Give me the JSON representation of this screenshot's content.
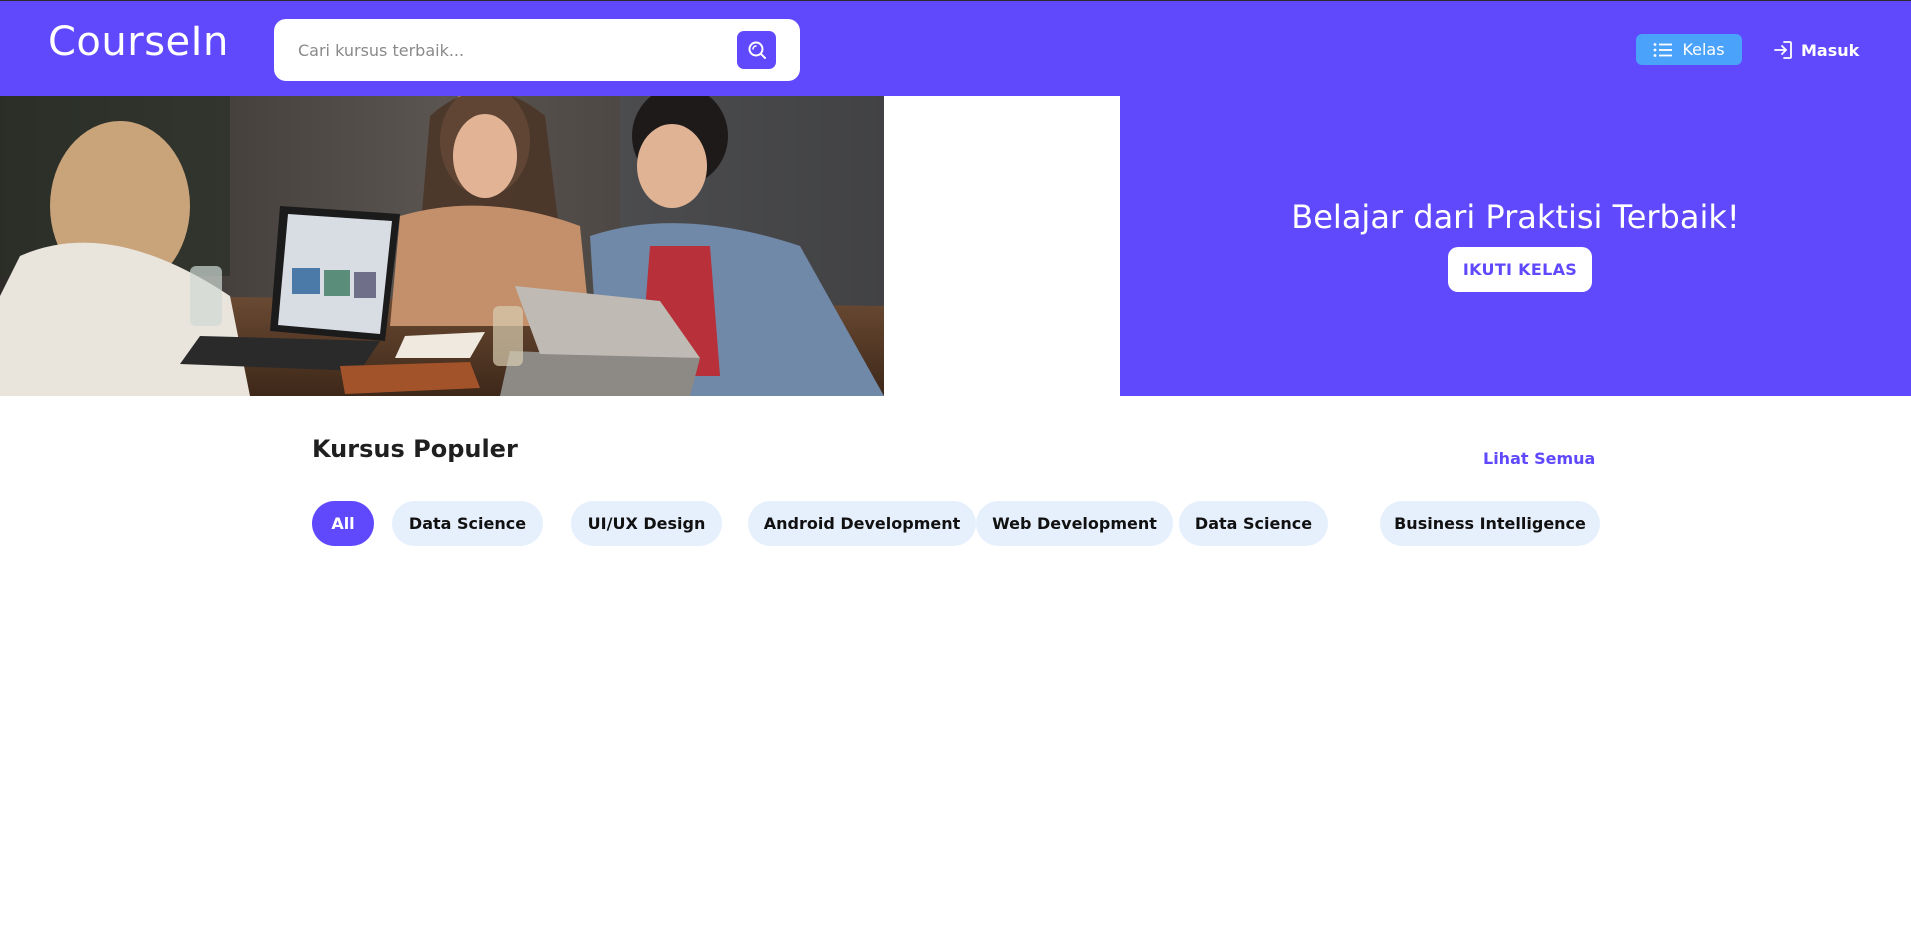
{
  "header": {
    "logo": "CourseIn",
    "search": {
      "placeholder": "Cari kursus terbaik...",
      "value": ""
    },
    "nav": {
      "kelas_label": "Kelas",
      "masuk_label": "Masuk"
    }
  },
  "hero": {
    "image_icon": "students-studying-photo",
    "title": "Belajar dari Praktisi Terbaik!",
    "cta_label": "IKUTI KELAS"
  },
  "popular": {
    "title": "Kursus Populer",
    "see_all_label": "Lihat Semua",
    "filters": [
      {
        "label": "All",
        "active": true
      },
      {
        "label": "Data Science",
        "active": false
      },
      {
        "label": "UI/UX Design",
        "active": false
      },
      {
        "label": "Android Development",
        "active": false
      },
      {
        "label": "Web Development",
        "active": false
      },
      {
        "label": "Data Science",
        "active": false
      },
      {
        "label": "Business Intelligence",
        "active": false
      }
    ]
  },
  "colors": {
    "brand": "#6049fd",
    "accent_blue": "#4aa2fb",
    "chip_bg": "#e6f0fc",
    "white": "#ffffff"
  }
}
